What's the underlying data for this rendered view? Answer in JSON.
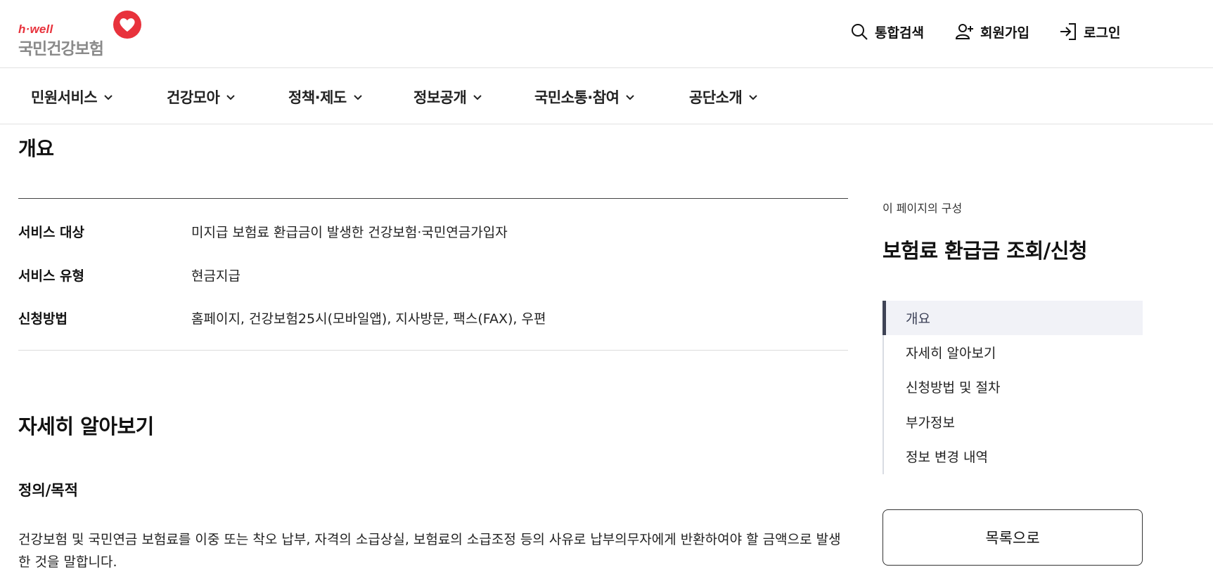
{
  "logo": {
    "tagline": "h·well",
    "name": "국민건강보험"
  },
  "header": {
    "search_label": "통합검색",
    "join_label": "회원가입",
    "login_label": "로그인"
  },
  "nav": {
    "items": [
      {
        "label": "민원서비스"
      },
      {
        "label": "건강모아"
      },
      {
        "label": "정책·제도"
      },
      {
        "label": "정보공개"
      },
      {
        "label": "국민소통·참여"
      },
      {
        "label": "공단소개"
      }
    ]
  },
  "overview": {
    "title": "개요",
    "rows": [
      {
        "key": "서비스 대상",
        "value": "미지급 보험료 환급금이 발생한 건강보험·국민연금가입자"
      },
      {
        "key": "서비스 유형",
        "value": "현금지급"
      },
      {
        "key": "신청방법",
        "value": "홈페이지, 건강보험25시(모바일앱), 지사방문, 팩스(FAX), 우편"
      }
    ]
  },
  "detail": {
    "title": "자세히 알아보기",
    "subtitle": "정의/목적",
    "description": "건강보험 및 국민연금 보험료를 이중 또는 착오 납부, 자격의 소급상실, 보험료의 소급조정 등의 사유로 납부의무자에게 반환하여야 할 금액으로 발생한 것을 말합니다."
  },
  "aside": {
    "caption": "이 페이지의 구성",
    "title": "보험료 환급금 조회/신청",
    "toc": [
      {
        "label": "개요",
        "active": true
      },
      {
        "label": "자세히 알아보기",
        "active": false
      },
      {
        "label": "신청방법 및 절차",
        "active": false
      },
      {
        "label": "부가정보",
        "active": false
      },
      {
        "label": "정보 변경 내역",
        "active": false
      }
    ],
    "list_button": "목록으로"
  },
  "colors": {
    "brand_red": "#e8323c",
    "logo_gray": "#8a8a8a",
    "toc_active_bg": "#f1f2f7",
    "toc_active_bar": "#3f4456"
  },
  "icons": {
    "search": "search-icon",
    "join": "user-plus-icon",
    "login": "login-arrow-icon",
    "nav_chevron": "chevron-down-icon",
    "logo_heart": "heart-logo-icon"
  }
}
